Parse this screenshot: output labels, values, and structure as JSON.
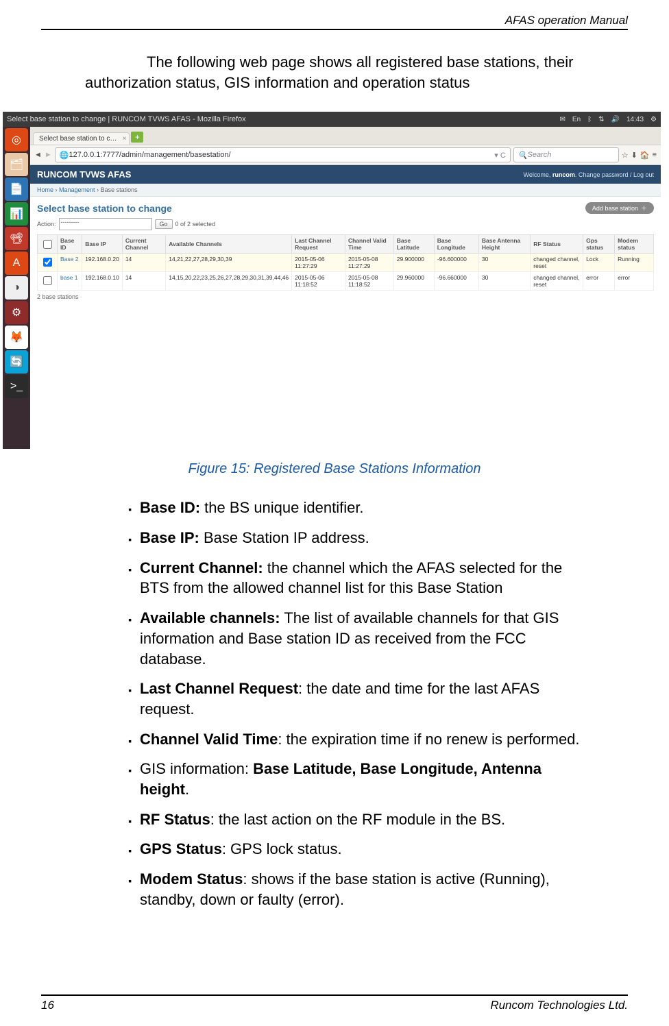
{
  "doc": {
    "header_title": "AFAS operation Manual",
    "intro": "The following web page shows all registered base stations, their authorization status, GIS information and operation status",
    "figure_caption": "Figure 15: Registered Base Stations Information",
    "footer_page": "16",
    "footer_company": "Runcom Technologies Ltd."
  },
  "shot": {
    "window_title": "Select base station to change | RUNCOM TVWS AFAS - Mozilla Firefox",
    "top_lang": "En",
    "top_time": "14:43",
    "tab": "Select base station to c…",
    "url": "127.0.0.1:7777/admin/management/basestation/",
    "search_placeholder": "Search",
    "brand": "RUNCOM TVWS AFAS",
    "welcome_prefix": "Welcome, ",
    "welcome_user": "runcom",
    "welcome_links": ". Change password / Log out",
    "crumb_home": "Home",
    "crumb_mgmt": "Management",
    "crumb_here": "Base stations",
    "page_title": "Select base station to change",
    "add_btn": "Add base station",
    "action_label": "Action:",
    "action_placeholder": "---------",
    "go": "Go",
    "selected_text": "0 of 2 selected",
    "headers": [
      "",
      "Base ID",
      "Base IP",
      "Current Channel",
      "Available Channels",
      "Last Channel Request",
      "Channel Valid Time",
      "Base Latitude",
      "Base Longitude",
      "Base Antenna Height",
      "RF Status",
      "Gps status",
      "Modem status"
    ],
    "rows": [
      {
        "sel": true,
        "id": "Base 2",
        "ip": "192.168.0.20",
        "cur": "14",
        "avail": "14,21,22,27,28,29,30,39",
        "req": "2015-05-06 11:27:29",
        "valid": "2015-05-08 11:27:29",
        "lat": "29.900000",
        "lon": "-96.600000",
        "h": "30",
        "rf": "changed channel, reset",
        "gps": "Lock",
        "modem": "Running"
      },
      {
        "sel": false,
        "id": "base 1",
        "ip": "192.168.0.10",
        "cur": "14",
        "avail": "14,15,20,22,23,25,26,27,28,29,30,31,39,44,46",
        "req": "2015-05-06 11:18:52",
        "valid": "2015-05-08 11:18:52",
        "lat": "29.960000",
        "lon": "-96.660000",
        "h": "30",
        "rf": "changed channel, reset",
        "gps": "error",
        "modem": "error"
      }
    ],
    "count": "2 base stations"
  },
  "bullets": [
    {
      "b": "Base ID:",
      "t": " the BS unique identifier."
    },
    {
      "b": "Base IP:",
      "t": " Base Station IP address."
    },
    {
      "b": "Current Channel:",
      "t": " the channel which the AFAS selected for the BTS from the allowed channel list for this Base Station"
    },
    {
      "b": "Available channels:",
      "t": " The list of available channels for that GIS information and Base station ID as received from the FCC database."
    },
    {
      "b": "Last Channel Request",
      "t": ": the date and time for the last AFAS request."
    },
    {
      "b": "Channel Valid Time",
      "t": ": the expiration time if no renew is performed."
    },
    {
      "pre": "GIS information: ",
      "b": "Base Latitude, Base Longitude, Antenna height",
      "t": "."
    },
    {
      "b": "RF Status",
      "t": ": the last action on the RF module in the BS."
    },
    {
      "b": "GPS Status",
      "t": ": GPS lock status."
    },
    {
      "b": "Modem Status",
      "t": ": shows if the base station is active (Running), standby, down or faulty (error)."
    }
  ]
}
